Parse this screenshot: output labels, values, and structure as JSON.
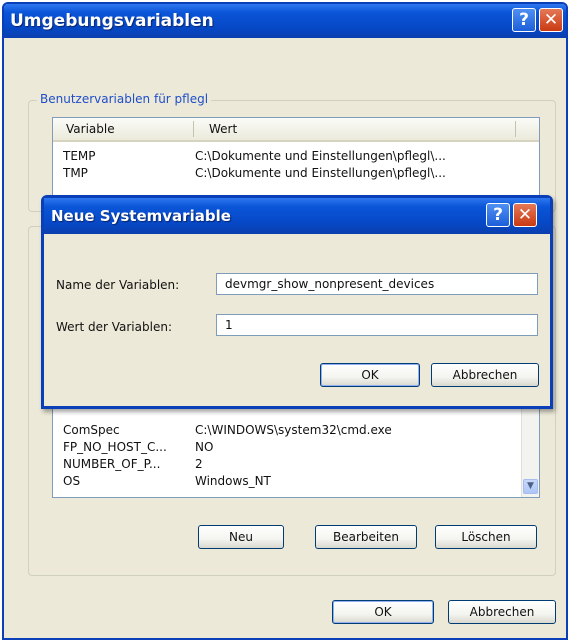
{
  "window": {
    "title": "Umgebungsvariablen",
    "help_glyph": "?",
    "close_glyph": "✕"
  },
  "user_vars": {
    "group_label": "Benutzervariablen für pflegl",
    "columns": [
      "Variable",
      "Wert"
    ],
    "rows": [
      {
        "variable": "TEMP",
        "value": "C:\\Dokumente und Einstellungen\\pflegl\\..."
      },
      {
        "variable": "TMP",
        "value": "C:\\Dokumente und Einstellungen\\pflegl\\..."
      }
    ]
  },
  "system_vars": {
    "rows": [
      {
        "variable": "ComSpec",
        "value": "C:\\WINDOWS\\system32\\cmd.exe"
      },
      {
        "variable": "FP_NO_HOST_C...",
        "value": "NO"
      },
      {
        "variable": "NUMBER_OF_P...",
        "value": "2"
      },
      {
        "variable": "OS",
        "value": "Windows_NT"
      }
    ],
    "buttons": {
      "new": "Neu",
      "edit": "Bearbeiten",
      "delete": "Löschen"
    }
  },
  "footer": {
    "ok": "OK",
    "cancel": "Abbrechen"
  },
  "dialog": {
    "title": "Neue Systemvariable",
    "help_glyph": "?",
    "close_glyph": "✕",
    "name_label": "Name der Variablen:",
    "name_value": "devmgr_show_nonpresent_devices",
    "value_label": "Wert der Variablen:",
    "value_value": "1",
    "ok": "OK",
    "cancel": "Abbrechen"
  },
  "icons": {
    "scroll_up": "scroll-up-arrow-icon",
    "scroll_down": "scroll-down-arrow-icon"
  },
  "colors": {
    "titlebar": "#0a55d8",
    "window_bg": "#ece9d8",
    "group_label": "#1f4ec9",
    "close_button": "#c93a12"
  }
}
